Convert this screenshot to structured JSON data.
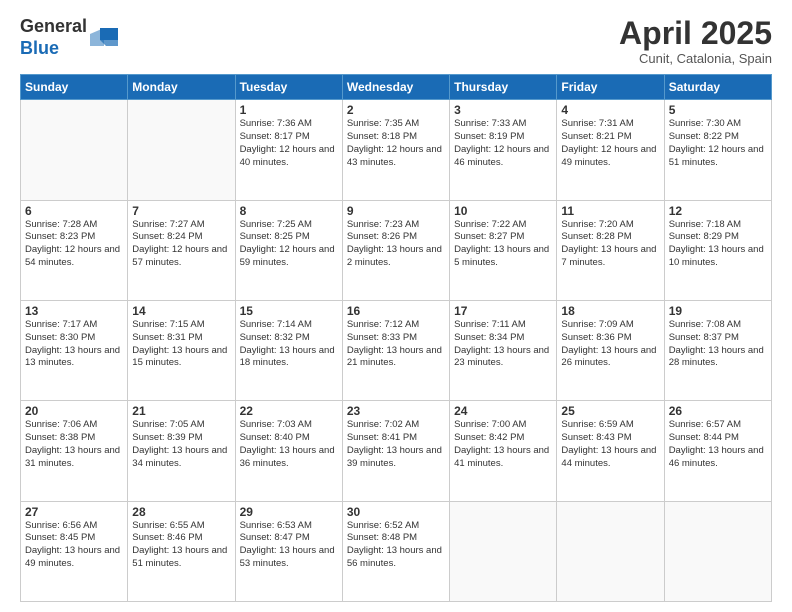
{
  "logo": {
    "general": "General",
    "blue": "Blue"
  },
  "title": "April 2025",
  "location": "Cunit, Catalonia, Spain",
  "days_of_week": [
    "Sunday",
    "Monday",
    "Tuesday",
    "Wednesday",
    "Thursday",
    "Friday",
    "Saturday"
  ],
  "weeks": [
    [
      {
        "day": "",
        "info": ""
      },
      {
        "day": "",
        "info": ""
      },
      {
        "day": "1",
        "info": "Sunrise: 7:36 AM\nSunset: 8:17 PM\nDaylight: 12 hours and 40 minutes."
      },
      {
        "day": "2",
        "info": "Sunrise: 7:35 AM\nSunset: 8:18 PM\nDaylight: 12 hours and 43 minutes."
      },
      {
        "day": "3",
        "info": "Sunrise: 7:33 AM\nSunset: 8:19 PM\nDaylight: 12 hours and 46 minutes."
      },
      {
        "day": "4",
        "info": "Sunrise: 7:31 AM\nSunset: 8:21 PM\nDaylight: 12 hours and 49 minutes."
      },
      {
        "day": "5",
        "info": "Sunrise: 7:30 AM\nSunset: 8:22 PM\nDaylight: 12 hours and 51 minutes."
      }
    ],
    [
      {
        "day": "6",
        "info": "Sunrise: 7:28 AM\nSunset: 8:23 PM\nDaylight: 12 hours and 54 minutes."
      },
      {
        "day": "7",
        "info": "Sunrise: 7:27 AM\nSunset: 8:24 PM\nDaylight: 12 hours and 57 minutes."
      },
      {
        "day": "8",
        "info": "Sunrise: 7:25 AM\nSunset: 8:25 PM\nDaylight: 12 hours and 59 minutes."
      },
      {
        "day": "9",
        "info": "Sunrise: 7:23 AM\nSunset: 8:26 PM\nDaylight: 13 hours and 2 minutes."
      },
      {
        "day": "10",
        "info": "Sunrise: 7:22 AM\nSunset: 8:27 PM\nDaylight: 13 hours and 5 minutes."
      },
      {
        "day": "11",
        "info": "Sunrise: 7:20 AM\nSunset: 8:28 PM\nDaylight: 13 hours and 7 minutes."
      },
      {
        "day": "12",
        "info": "Sunrise: 7:18 AM\nSunset: 8:29 PM\nDaylight: 13 hours and 10 minutes."
      }
    ],
    [
      {
        "day": "13",
        "info": "Sunrise: 7:17 AM\nSunset: 8:30 PM\nDaylight: 13 hours and 13 minutes."
      },
      {
        "day": "14",
        "info": "Sunrise: 7:15 AM\nSunset: 8:31 PM\nDaylight: 13 hours and 15 minutes."
      },
      {
        "day": "15",
        "info": "Sunrise: 7:14 AM\nSunset: 8:32 PM\nDaylight: 13 hours and 18 minutes."
      },
      {
        "day": "16",
        "info": "Sunrise: 7:12 AM\nSunset: 8:33 PM\nDaylight: 13 hours and 21 minutes."
      },
      {
        "day": "17",
        "info": "Sunrise: 7:11 AM\nSunset: 8:34 PM\nDaylight: 13 hours and 23 minutes."
      },
      {
        "day": "18",
        "info": "Sunrise: 7:09 AM\nSunset: 8:36 PM\nDaylight: 13 hours and 26 minutes."
      },
      {
        "day": "19",
        "info": "Sunrise: 7:08 AM\nSunset: 8:37 PM\nDaylight: 13 hours and 28 minutes."
      }
    ],
    [
      {
        "day": "20",
        "info": "Sunrise: 7:06 AM\nSunset: 8:38 PM\nDaylight: 13 hours and 31 minutes."
      },
      {
        "day": "21",
        "info": "Sunrise: 7:05 AM\nSunset: 8:39 PM\nDaylight: 13 hours and 34 minutes."
      },
      {
        "day": "22",
        "info": "Sunrise: 7:03 AM\nSunset: 8:40 PM\nDaylight: 13 hours and 36 minutes."
      },
      {
        "day": "23",
        "info": "Sunrise: 7:02 AM\nSunset: 8:41 PM\nDaylight: 13 hours and 39 minutes."
      },
      {
        "day": "24",
        "info": "Sunrise: 7:00 AM\nSunset: 8:42 PM\nDaylight: 13 hours and 41 minutes."
      },
      {
        "day": "25",
        "info": "Sunrise: 6:59 AM\nSunset: 8:43 PM\nDaylight: 13 hours and 44 minutes."
      },
      {
        "day": "26",
        "info": "Sunrise: 6:57 AM\nSunset: 8:44 PM\nDaylight: 13 hours and 46 minutes."
      }
    ],
    [
      {
        "day": "27",
        "info": "Sunrise: 6:56 AM\nSunset: 8:45 PM\nDaylight: 13 hours and 49 minutes."
      },
      {
        "day": "28",
        "info": "Sunrise: 6:55 AM\nSunset: 8:46 PM\nDaylight: 13 hours and 51 minutes."
      },
      {
        "day": "29",
        "info": "Sunrise: 6:53 AM\nSunset: 8:47 PM\nDaylight: 13 hours and 53 minutes."
      },
      {
        "day": "30",
        "info": "Sunrise: 6:52 AM\nSunset: 8:48 PM\nDaylight: 13 hours and 56 minutes."
      },
      {
        "day": "",
        "info": ""
      },
      {
        "day": "",
        "info": ""
      },
      {
        "day": "",
        "info": ""
      }
    ]
  ]
}
